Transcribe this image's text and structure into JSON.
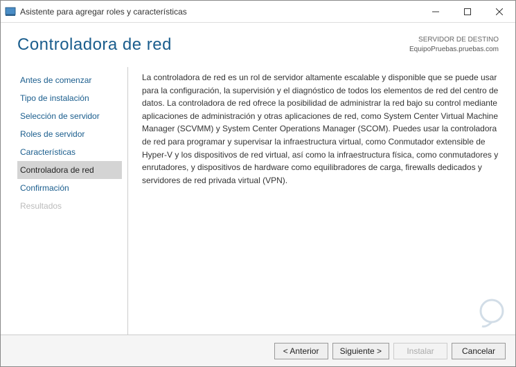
{
  "titlebar": {
    "title": "Asistente para agregar roles y características"
  },
  "header": {
    "page_title": "Controladora de red",
    "dest_label": "SERVIDOR DE DESTINO",
    "dest_server": "EquipoPruebas.pruebas.com"
  },
  "sidebar": {
    "items": [
      {
        "label": "Antes de comenzar"
      },
      {
        "label": "Tipo de instalación"
      },
      {
        "label": "Selección de servidor"
      },
      {
        "label": "Roles de servidor"
      },
      {
        "label": "Características"
      },
      {
        "label": "Controladora de red"
      },
      {
        "label": "Confirmación"
      },
      {
        "label": "Resultados"
      }
    ]
  },
  "content": {
    "text": "La controladora de red es un rol de servidor altamente escalable y disponible que se puede usar para la configuración, la supervisión y el diagnóstico de todos los elementos de red del centro de datos. La controladora de red ofrece la posibilidad de administrar la red bajo su control mediante aplicaciones de administración y otras aplicaciones de red, como System Center Virtual Machine Manager (SCVMM) y System Center Operations Manager (SCOM). Puedes usar la controladora de red para programar y supervisar la infraestructura virtual, como Conmutador extensible de Hyper-V y los dispositivos de red virtual, así como la infraestructura física, como conmutadores y enrutadores, y dispositivos de hardware como equilibradores de carga, firewalls dedicados y servidores de red privada virtual (VPN)."
  },
  "footer": {
    "prev": "< Anterior",
    "next": "Siguiente >",
    "install": "Instalar",
    "cancel": "Cancelar"
  }
}
